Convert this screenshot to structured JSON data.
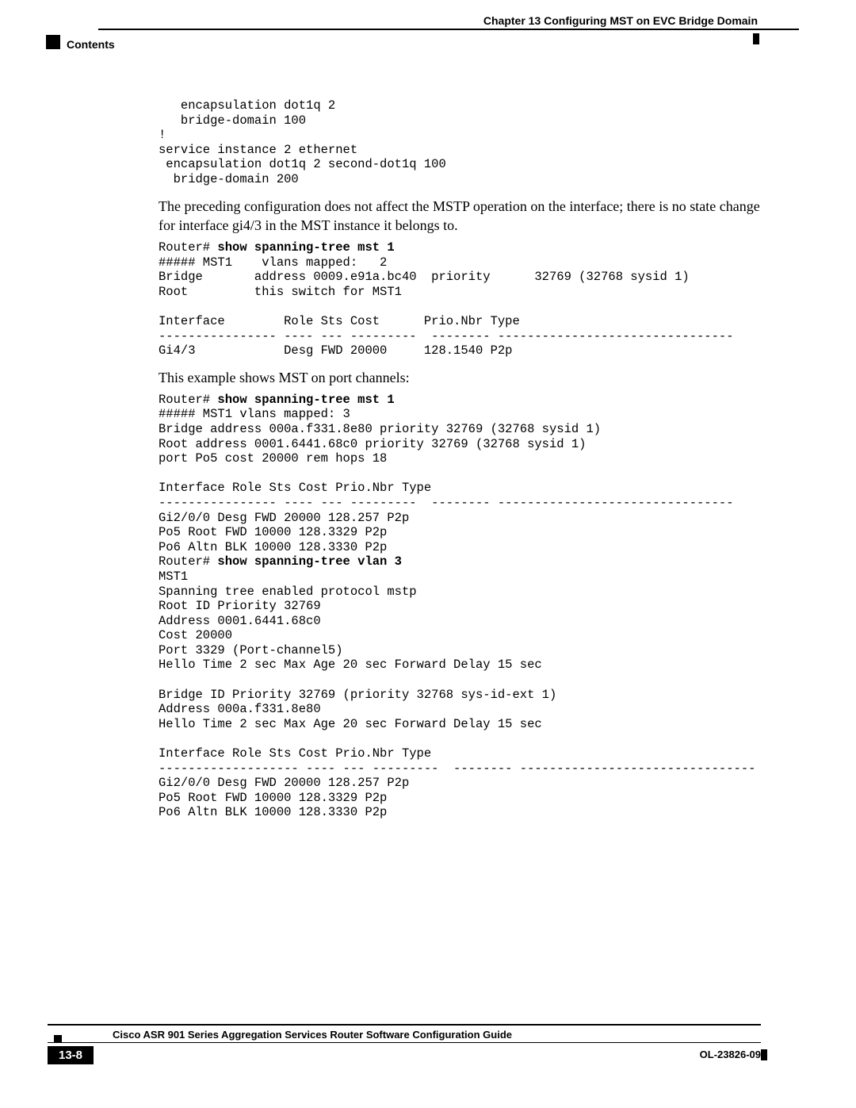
{
  "header": {
    "chapter": "Chapter 13    Configuring MST on EVC Bridge Domain",
    "contents_label": "Contents"
  },
  "body": {
    "code1": "   encapsulation dot1q 2\n   bridge-domain 100\n!\nservice instance 2 ethernet\n encapsulation dot1q 2 second-dot1q 100\n  bridge-domain 200",
    "para1": "The preceding configuration does not affect the MSTP operation on the interface; there is no state change for interface gi4/3 in the MST instance it belongs to.",
    "code2_prompt": "Router# ",
    "code2_cmd": "show spanning-tree mst 1",
    "code2_out": "\n##### MST1    vlans mapped:   2\nBridge       address 0009.e91a.bc40  priority      32769 (32768 sysid 1)\nRoot         this switch for MST1\n\nInterface        Role Sts Cost      Prio.Nbr Type\n---------------- ---- --- ---------  -------- --------------------------------\nGi4/3            Desg FWD 20000     128.1540 P2p",
    "para2": "This example shows MST on port channels:",
    "code3_prompt": "Router# ",
    "code3_cmd": "show spanning-tree mst 1",
    "code3_out": "##### MST1 vlans mapped: 3\nBridge address 000a.f331.8e80 priority 32769 (32768 sysid 1)\nRoot address 0001.6441.68c0 priority 32769 (32768 sysid 1)\nport Po5 cost 20000 rem hops 18\n\nInterface Role Sts Cost Prio.Nbr Type\n---------------- ---- --- ---------  -------- --------------------------------\nGi2/0/0 Desg FWD 20000 128.257 P2p\nPo5 Root FWD 10000 128.3329 P2p\nPo6 Altn BLK 10000 128.3330 P2p",
    "code4_prompt": "\nRouter# ",
    "code4_cmd": "show spanning-tree vlan 3",
    "code4_out": "\nMST1\nSpanning tree enabled protocol mstp\nRoot ID Priority 32769\nAddress 0001.6441.68c0\nCost 20000\nPort 3329 (Port-channel5)\nHello Time 2 sec Max Age 20 sec Forward Delay 15 sec\n\nBridge ID Priority 32769 (priority 32768 sys-id-ext 1)\nAddress 000a.f331.8e80\nHello Time 2 sec Max Age 20 sec Forward Delay 15 sec\n\nInterface Role Sts Cost Prio.Nbr Type\n------------------- ---- --- ---------  -------- --------------------------------\nGi2/0/0 Desg FWD 20000 128.257 P2p\nPo5 Root FWD 10000 128.3329 P2p\nPo6 Altn BLK 10000 128.3330 P2p"
  },
  "footer": {
    "guide": "Cisco ASR 901 Series Aggregation Services Router Software Configuration Guide",
    "page": "13-8",
    "docid": "OL-23826-09"
  }
}
